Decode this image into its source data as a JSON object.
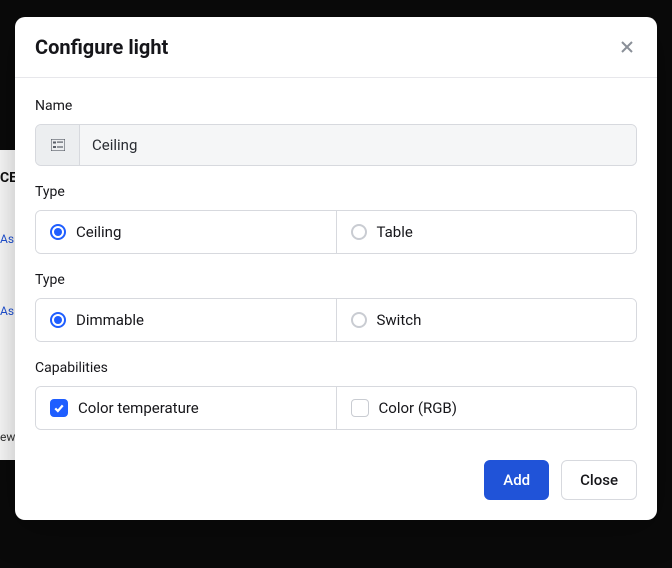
{
  "modal": {
    "title": "Configure light",
    "name_section": {
      "label": "Name",
      "value": "Ceiling"
    },
    "type1_section": {
      "label": "Type",
      "options": [
        {
          "label": "Ceiling",
          "selected": true
        },
        {
          "label": "Table",
          "selected": false
        }
      ]
    },
    "type2_section": {
      "label": "Type",
      "options": [
        {
          "label": "Dimmable",
          "selected": true
        },
        {
          "label": "Switch",
          "selected": false
        }
      ]
    },
    "capabilities_section": {
      "label": "Capabilities",
      "options": [
        {
          "label": "Color temperature",
          "checked": true
        },
        {
          "label": "Color (RGB)",
          "checked": false
        }
      ]
    },
    "footer": {
      "add": "Add",
      "close": "Close"
    }
  },
  "colors": {
    "primary": "#2053d8",
    "accent": "#1f5eff"
  },
  "background_fragments": {
    "a": "CE",
    "b": "As",
    "c": "As",
    "d": "ew"
  }
}
